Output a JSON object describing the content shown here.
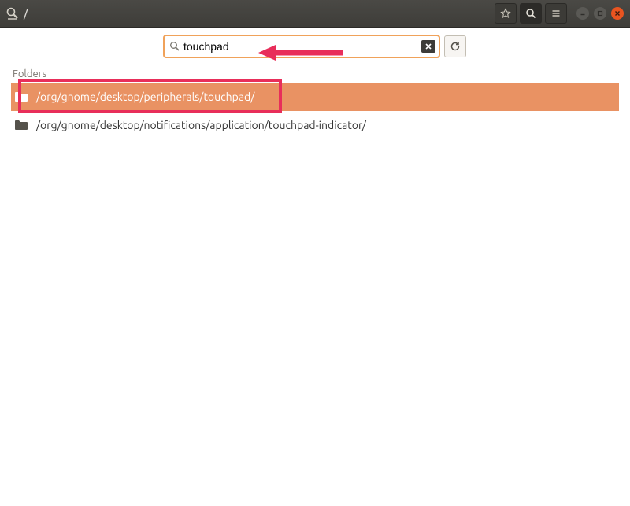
{
  "titlebar": {
    "path": "/"
  },
  "search": {
    "value": "touchpad"
  },
  "section_label": "Folders",
  "results": [
    {
      "path": "/org/gnome/desktop/peripherals/touchpad/",
      "selected": true
    },
    {
      "path": "/org/gnome/desktop/notifications/application/touchpad-indicator/",
      "selected": false
    }
  ],
  "colors": {
    "accent": "#e95420",
    "selection": "#e99263",
    "annotation": "#e82e5a"
  }
}
